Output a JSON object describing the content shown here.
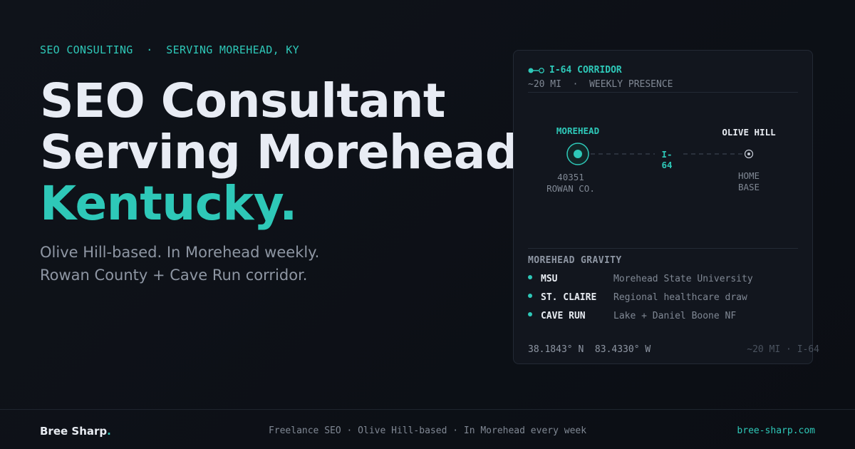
{
  "eyebrow": "SEO CONSULTING  ·  SERVING MOREHEAD, KY",
  "headline": {
    "line1": "SEO Consultant",
    "line2": "Serving Morehead,",
    "line3": "Kentucky."
  },
  "subhead": {
    "line1": "Olive Hill-based. In Morehead weekly.",
    "line2": "Rowan County + Cave Run corridor."
  },
  "card": {
    "title": "I-64 CORRIDOR",
    "subtitle": "~20 MI  ·  WEEKLY PRESENCE",
    "route_label": "I-64",
    "left_node": {
      "name": "MOREHEAD",
      "line1": "40351",
      "line2": "ROWAN CO."
    },
    "right_node": {
      "name": "OLIVE HILL",
      "line1": "HOME",
      "line2": "BASE"
    },
    "gravity_title": "MOREHEAD GRAVITY",
    "gravity": [
      {
        "key": "MSU",
        "value": "Morehead State University"
      },
      {
        "key": "ST. CLAIRE",
        "value": "Regional healthcare draw"
      },
      {
        "key": "CAVE RUN",
        "value": "Lake + Daniel Boone NF"
      }
    ],
    "coords": "38.1843° N  83.4330° W",
    "distance": "~20 MI · I-64"
  },
  "footer": {
    "brand": "Bree Sharp",
    "brand_dot": ".",
    "tagline": "Freelance SEO · Olive Hill-based · In Morehead every week",
    "site": "bree-sharp.com"
  },
  "colors": {
    "accent": "#2ec8b8",
    "background": "#0d1117",
    "text": "#e8ecf2",
    "muted": "#808894"
  }
}
